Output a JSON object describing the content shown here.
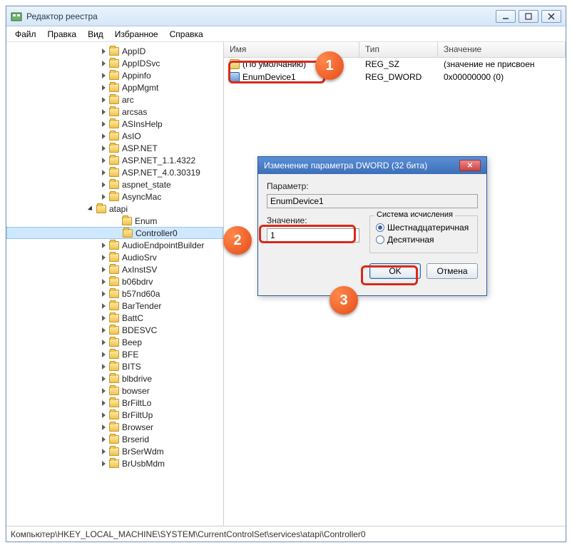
{
  "window": {
    "title": "Редактор реестра"
  },
  "menu": {
    "file": "Файл",
    "edit": "Правка",
    "view": "Вид",
    "favorites": "Избранное",
    "help": "Справка"
  },
  "tree_items": [
    {
      "label": "AppID",
      "exp": "closed",
      "depth": 0
    },
    {
      "label": "AppIDSvc",
      "exp": "closed",
      "depth": 0
    },
    {
      "label": "Appinfo",
      "exp": "closed",
      "depth": 0
    },
    {
      "label": "AppMgmt",
      "exp": "closed",
      "depth": 0
    },
    {
      "label": "arc",
      "exp": "closed",
      "depth": 0
    },
    {
      "label": "arcsas",
      "exp": "closed",
      "depth": 0
    },
    {
      "label": "ASInsHelp",
      "exp": "closed",
      "depth": 0
    },
    {
      "label": "AsIO",
      "exp": "closed",
      "depth": 0
    },
    {
      "label": "ASP.NET",
      "exp": "closed",
      "depth": 0
    },
    {
      "label": "ASP.NET_1.1.4322",
      "exp": "closed",
      "depth": 0
    },
    {
      "label": "ASP.NET_4.0.30319",
      "exp": "closed",
      "depth": 0
    },
    {
      "label": "aspnet_state",
      "exp": "closed",
      "depth": 0
    },
    {
      "label": "AsyncMac",
      "exp": "closed",
      "depth": 0
    },
    {
      "label": "atapi",
      "exp": "open",
      "depth": 1
    },
    {
      "label": "Enum",
      "exp": "none",
      "depth": 2
    },
    {
      "label": "Controller0",
      "exp": "none",
      "depth": 2,
      "selected": true
    },
    {
      "label": "AudioEndpointBuilder",
      "exp": "closed",
      "depth": 0
    },
    {
      "label": "AudioSrv",
      "exp": "closed",
      "depth": 0
    },
    {
      "label": "AxInstSV",
      "exp": "closed",
      "depth": 0
    },
    {
      "label": "b06bdrv",
      "exp": "closed",
      "depth": 0
    },
    {
      "label": "b57nd60a",
      "exp": "closed",
      "depth": 0
    },
    {
      "label": "BarTender",
      "exp": "closed",
      "depth": 0
    },
    {
      "label": "BattC",
      "exp": "closed",
      "depth": 0
    },
    {
      "label": "BDESVC",
      "exp": "closed",
      "depth": 0
    },
    {
      "label": "Beep",
      "exp": "closed",
      "depth": 0
    },
    {
      "label": "BFE",
      "exp": "closed",
      "depth": 0
    },
    {
      "label": "BITS",
      "exp": "closed",
      "depth": 0
    },
    {
      "label": "blbdrive",
      "exp": "closed",
      "depth": 0
    },
    {
      "label": "bowser",
      "exp": "closed",
      "depth": 0
    },
    {
      "label": "BrFiltLo",
      "exp": "closed",
      "depth": 0
    },
    {
      "label": "BrFiltUp",
      "exp": "closed",
      "depth": 0
    },
    {
      "label": "Browser",
      "exp": "closed",
      "depth": 0
    },
    {
      "label": "Brserid",
      "exp": "closed",
      "depth": 0
    },
    {
      "label": "BrSerWdm",
      "exp": "closed",
      "depth": 0
    },
    {
      "label": "BrUsbMdm",
      "exp": "closed",
      "depth": 0
    }
  ],
  "columns": {
    "name": "Имя",
    "type": "Тип",
    "value": "Значение"
  },
  "rows": [
    {
      "name": "(По умолчанию)",
      "type": "REG_SZ",
      "value": "(значение не присвоен",
      "icon": "sz"
    },
    {
      "name": "EnumDevice1",
      "type": "REG_DWORD",
      "value": "0x00000000 (0)",
      "icon": "dword"
    }
  ],
  "dialog": {
    "title": "Изменение параметра DWORD (32 бита)",
    "param_label": "Параметр:",
    "param_value": "EnumDevice1",
    "value_label": "Значение:",
    "value_input": "1",
    "base_label": "Система исчисления",
    "radio_hex": "Шестнадцатеричная",
    "radio_dec": "Десятичная",
    "ok": "OK",
    "cancel": "Отмена"
  },
  "status": "Компьютер\\HKEY_LOCAL_MACHINE\\SYSTEM\\CurrentControlSet\\services\\atapi\\Controller0",
  "markers": {
    "m1": "1",
    "m2": "2",
    "m3": "3"
  }
}
